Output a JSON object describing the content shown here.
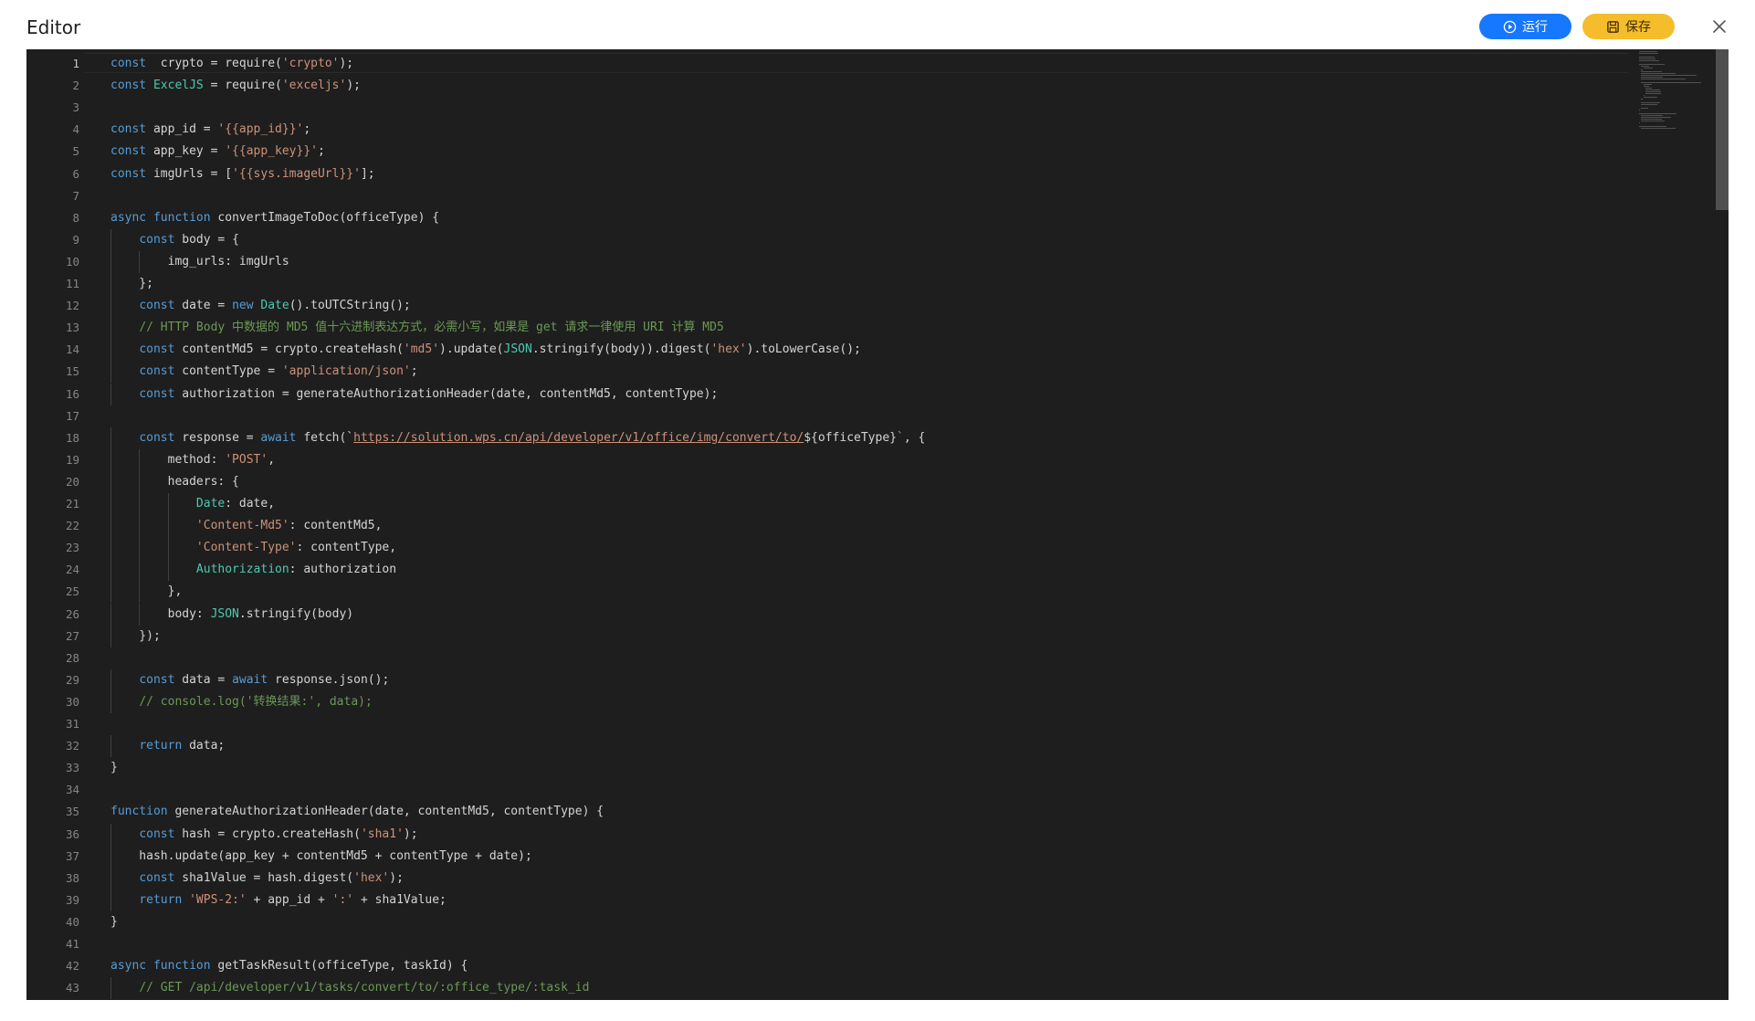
{
  "dialog": {
    "title": "Editor",
    "run_label": "运行",
    "save_label": "保存"
  },
  "colors": {
    "run_button": "#1677ff",
    "save_button": "#f5bd2c",
    "editor_bg": "#1e1e1e"
  },
  "icons": [
    "play-circle-icon",
    "save-icon",
    "close-icon"
  ],
  "editor": {
    "active_line": 1,
    "line_numbers": [
      "1",
      "2",
      "3",
      "4",
      "5",
      "6",
      "7",
      "8",
      "9",
      "10",
      "11",
      "12",
      "13",
      "14",
      "15",
      "16",
      "17",
      "18",
      "19",
      "20",
      "21",
      "22",
      "23",
      "24",
      "25",
      "26",
      "27",
      "28",
      "29",
      "30",
      "31",
      "32",
      "33",
      "34",
      "35",
      "36",
      "37",
      "38",
      "39",
      "40",
      "41",
      "42",
      "43"
    ],
    "lines": [
      [
        [
          "kw",
          "const"
        ],
        [
          "",
          "  crypto = require("
        ],
        [
          "str",
          "'crypto'"
        ],
        [
          "",
          ");"
        ]
      ],
      [
        [
          "kw",
          "const"
        ],
        [
          "",
          ""
        ],
        [
          "cls",
          "ExcelJS"
        ],
        [
          "",
          " = require("
        ],
        [
          "str",
          "'exceljs'"
        ],
        [
          "",
          ");"
        ]
      ],
      [],
      [
        [
          "kw",
          "const"
        ],
        [
          "",
          " app_id = "
        ],
        [
          "str",
          "'{{app_id}}'"
        ],
        [
          "",
          ";"
        ]
      ],
      [
        [
          "kw",
          "const"
        ],
        [
          "",
          " app_key = "
        ],
        [
          "str",
          "'{{app_key}}'"
        ],
        [
          "",
          ";"
        ]
      ],
      [
        [
          "kw",
          "const"
        ],
        [
          "",
          " imgUrls = ["
        ],
        [
          "str",
          "'{{sys.imageUrl}}'"
        ],
        [
          "",
          "];"
        ]
      ],
      [],
      [
        [
          "kw",
          "async"
        ],
        [
          "",
          ""
        ],
        [
          "kw",
          "function"
        ],
        [
          "",
          " convertImageToDoc(officeType) {"
        ]
      ],
      [
        [
          "",
          "    "
        ],
        [
          "kw",
          "const"
        ],
        [
          "",
          " body = {"
        ]
      ],
      [
        [
          "",
          "        img_urls: imgUrls"
        ]
      ],
      [
        [
          "",
          "    };"
        ]
      ],
      [
        [
          "",
          "    "
        ],
        [
          "kw",
          "const"
        ],
        [
          "",
          " date = "
        ],
        [
          "kw",
          "new"
        ],
        [
          "",
          ""
        ],
        [
          "cls",
          "Date"
        ],
        [
          "",
          "().toUTCString();"
        ]
      ],
      [
        [
          "",
          "    "
        ],
        [
          "cm",
          "// HTTP Body 中数据的 MD5 值十六进制表达方式，必需小写，如果是 get 请求一律使用 URI 计算 MD5"
        ]
      ],
      [
        [
          "",
          "    "
        ],
        [
          "kw",
          "const"
        ],
        [
          "",
          " contentMd5 = crypto.createHash("
        ],
        [
          "str",
          "'md5'"
        ],
        [
          "",
          ").update("
        ],
        [
          "cls",
          "JSON"
        ],
        [
          "",
          ".stringify(body)).digest("
        ],
        [
          "str",
          "'hex'"
        ],
        [
          "",
          ").toLowerCase();"
        ]
      ],
      [
        [
          "",
          "    "
        ],
        [
          "kw",
          "const"
        ],
        [
          "",
          " contentType = "
        ],
        [
          "str",
          "'application/json'"
        ],
        [
          "",
          ";"
        ]
      ],
      [
        [
          "",
          "    "
        ],
        [
          "kw",
          "const"
        ],
        [
          "",
          " authorization = generateAuthorizationHeader(date, contentMd5, contentType);"
        ]
      ],
      [],
      [
        [
          "",
          "    "
        ],
        [
          "kw",
          "const"
        ],
        [
          "",
          " response = "
        ],
        [
          "kw",
          "await"
        ],
        [
          "",
          " fetch(`"
        ],
        [
          "url",
          "https://solution.wps.cn/api/developer/v1/office/img/convert/to/"
        ],
        [
          "",
          "${officeType}"
        ],
        [
          "str",
          "`"
        ],
        [
          "",
          ", {"
        ]
      ],
      [
        [
          "",
          "        method: "
        ],
        [
          "str",
          "'POST'"
        ],
        [
          "",
          ","
        ]
      ],
      [
        [
          "",
          "        headers: {"
        ]
      ],
      [
        [
          "",
          "            "
        ],
        [
          "cls",
          "Date"
        ],
        [
          "",
          ": date,"
        ]
      ],
      [
        [
          "",
          "            "
        ],
        [
          "str",
          "'Content-Md5'"
        ],
        [
          "",
          ": contentMd5,"
        ]
      ],
      [
        [
          "",
          "            "
        ],
        [
          "str",
          "'Content-Type'"
        ],
        [
          "",
          ": contentType,"
        ]
      ],
      [
        [
          "",
          "            "
        ],
        [
          "cls",
          "Authorization"
        ],
        [
          "",
          ": authorization"
        ]
      ],
      [
        [
          "",
          "        },"
        ]
      ],
      [
        [
          "",
          "        body: "
        ],
        [
          "cls",
          "JSON"
        ],
        [
          "",
          ".stringify(body)"
        ]
      ],
      [
        [
          "",
          "    });"
        ]
      ],
      [],
      [
        [
          "",
          "    "
        ],
        [
          "kw",
          "const"
        ],
        [
          "",
          " data = "
        ],
        [
          "kw",
          "await"
        ],
        [
          "",
          " response.json();"
        ]
      ],
      [
        [
          "",
          "    "
        ],
        [
          "cm",
          "// console.log('转换结果:', data);"
        ]
      ],
      [],
      [
        [
          "",
          "    "
        ],
        [
          "kw",
          "return"
        ],
        [
          "",
          " data;"
        ]
      ],
      [
        [
          "",
          "}"
        ]
      ],
      [],
      [
        [
          "kw",
          "function"
        ],
        [
          "",
          " generateAuthorizationHeader(date, contentMd5, contentType) {"
        ]
      ],
      [
        [
          "",
          "    "
        ],
        [
          "kw",
          "const"
        ],
        [
          "",
          " hash = crypto.createHash("
        ],
        [
          "str",
          "'sha1'"
        ],
        [
          "",
          ");"
        ]
      ],
      [
        [
          "",
          "    hash.update(app_key + contentMd5 + contentType + date);"
        ]
      ],
      [
        [
          "",
          "    "
        ],
        [
          "kw",
          "const"
        ],
        [
          "",
          " sha1Value = hash.digest("
        ],
        [
          "str",
          "'hex'"
        ],
        [
          "",
          ");"
        ]
      ],
      [
        [
          "",
          "    "
        ],
        [
          "kw",
          "return"
        ],
        [
          "",
          ""
        ],
        [
          "str",
          "'WPS-2:'"
        ],
        [
          "",
          " + app_id + "
        ],
        [
          "str",
          "':'"
        ],
        [
          "",
          " + sha1Value;"
        ]
      ],
      [
        [
          "",
          "}"
        ]
      ],
      [],
      [
        [
          "kw",
          "async"
        ],
        [
          "",
          ""
        ],
        [
          "kw",
          "function"
        ],
        [
          "",
          " getTaskResult(officeType, taskId) {"
        ]
      ],
      [
        [
          "",
          "    "
        ],
        [
          "cm",
          "// GET /api/developer/v1/tasks/convert/to/:office_type/:task_id"
        ]
      ]
    ]
  }
}
